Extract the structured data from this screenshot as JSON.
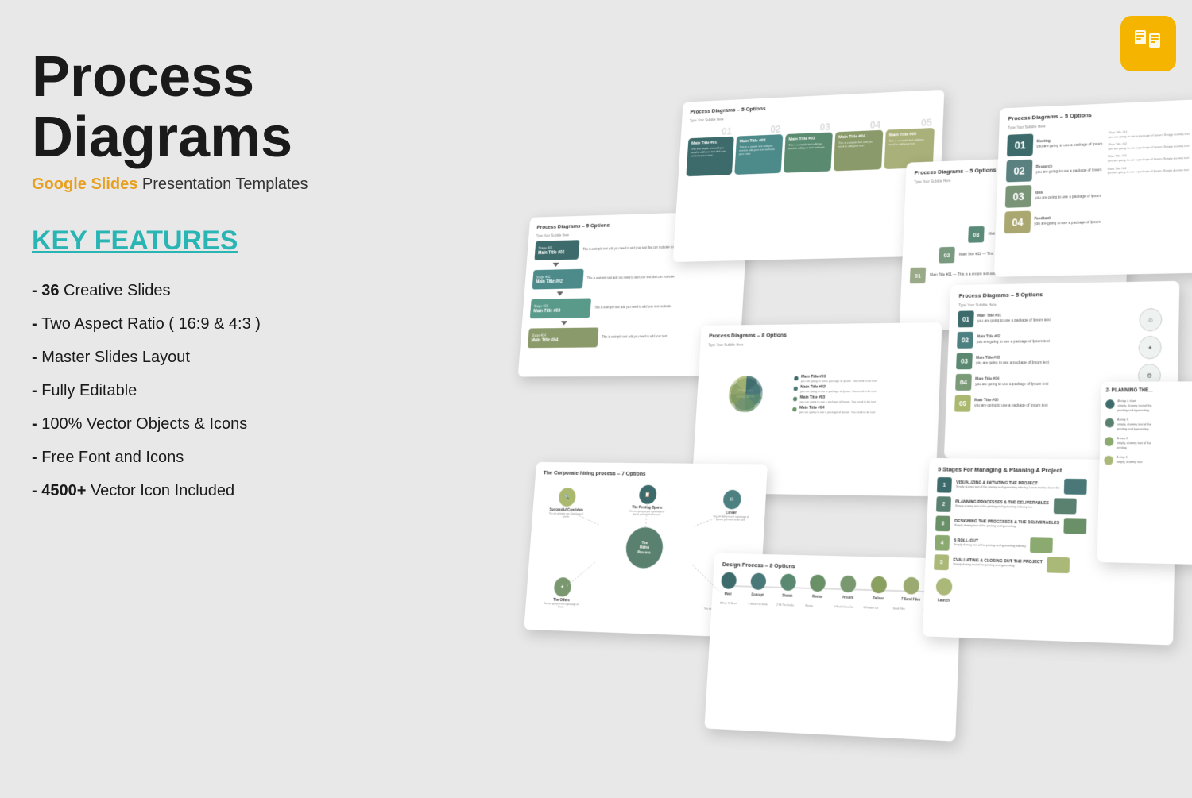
{
  "page": {
    "title": "Process Diagrams",
    "subtitle_brand": "Google Slides",
    "subtitle_rest": " Presentation Templates",
    "features_heading": "KEY FEATURES",
    "features": [
      {
        "bold": "36",
        "text": " Creative Slides"
      },
      {
        "bold": "",
        "text": "Two Aspect Ratio ( 16:9 & 4:3 )"
      },
      {
        "bold": "",
        "text": "Master Slides Layout"
      },
      {
        "bold": "",
        "text": "Fully Editable"
      },
      {
        "bold": "",
        "text": "100% Vector Objects & Icons"
      },
      {
        "bold": "",
        "text": "Free Font and Icons"
      },
      {
        "bold": "4500+",
        "text": " Vector Icon Included"
      }
    ]
  },
  "slides": {
    "slide1_title": "Process Diagrams – 5 Options",
    "slide2_title": "Process Diagrams – 5 Options",
    "slide3_title": "Process Diagrams – 5 Options",
    "slide4_title": "Process Diagrams – 5 Options",
    "slide5_title": "Process Diagrams – 8 Options",
    "slide6_title": "Process Diagrams – 5 Options",
    "slide7_title": "The Corporate hiring process – 7 Options",
    "slide8_title": "Design Process – 8 Options",
    "slide9_title": "5 Stages For Managing & Planning A Project",
    "slide10_title": "2- PLANNING THE..."
  },
  "icons": {
    "google_slides": "▣"
  }
}
